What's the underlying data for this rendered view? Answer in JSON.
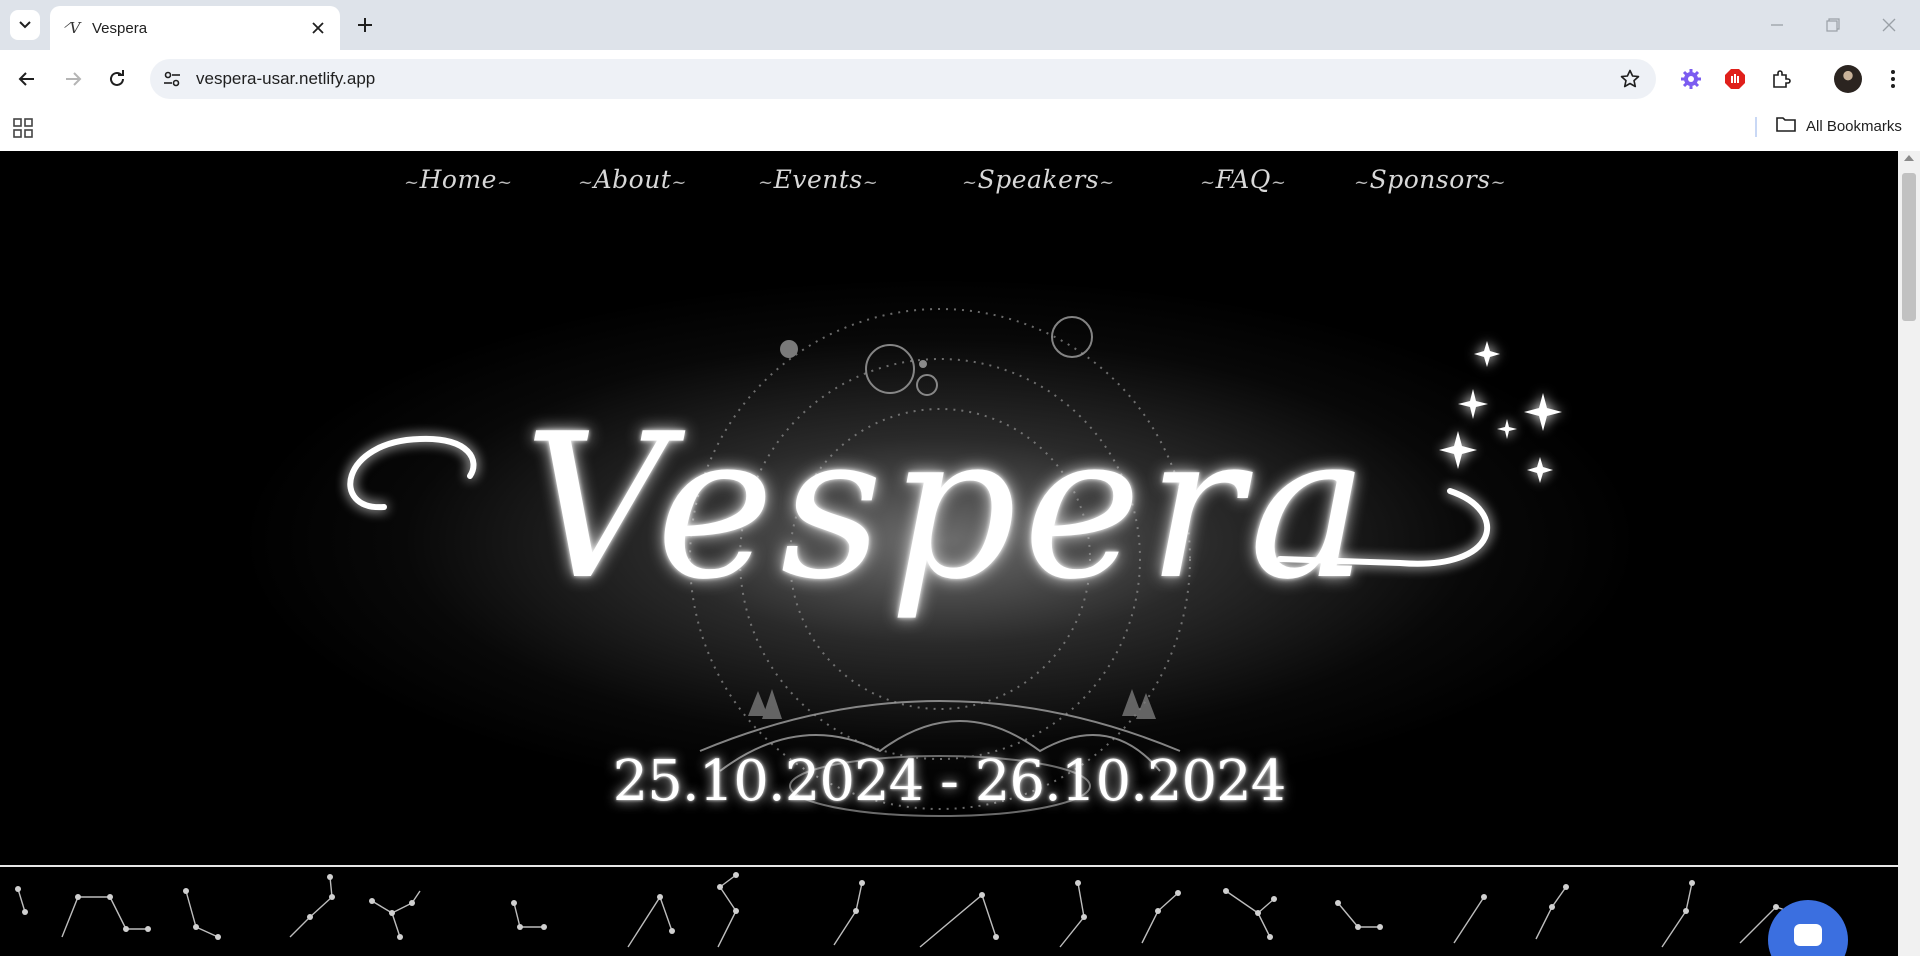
{
  "browser": {
    "tab_title": "Vespera",
    "tab_favicon": "⸍V",
    "url": "vespera-usar.netlify.app",
    "bookmarks_label": "All Bookmarks",
    "icons": [
      "tab-search-icon",
      "close-icon",
      "plus-icon",
      "minimize-icon",
      "restore-icon",
      "window-close-icon",
      "back-icon",
      "forward-icon",
      "reload-icon",
      "site-info-icon",
      "star-icon",
      "extension-gear-icon",
      "adblock-icon",
      "puzzle-icon",
      "avatar",
      "kebab-menu-icon",
      "apps-icon",
      "folder-icon"
    ]
  },
  "site": {
    "nav": [
      "Home",
      "About",
      "Events",
      "Speakers",
      "FAQ",
      "Sponsors"
    ],
    "title": "Vespera",
    "dates": "25.10.2024 - 26.10.2024"
  },
  "colors": {
    "page_bg": "#000000",
    "text": "#ffffff",
    "chat_button": "#3b6fe0",
    "tabstrip": "#dee3ea"
  }
}
